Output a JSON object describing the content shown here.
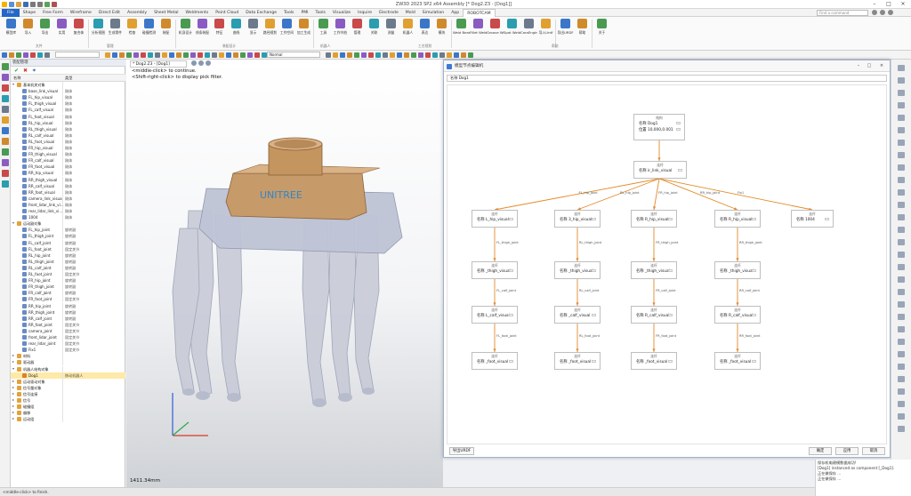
{
  "app": {
    "title": "ZW3D 2023 SP2 x64        Assembly  [* Dog2.Z3 - [Dog1]]",
    "search_placeholder": "Find a command"
  },
  "menu": {
    "tabs": [
      "File",
      "Shape",
      "Free Form",
      "Wireframe",
      "Direct Edit",
      "Assembly",
      "Sheet Metal",
      "Weldments",
      "Point Cloud",
      "Data Exchange",
      "Tools",
      "PMI",
      "Tools",
      "Visualize",
      "Inquire",
      "Electrode",
      "Mold",
      "Simulation",
      "App",
      "ROBOTCAM"
    ]
  },
  "ribbon": {
    "buttons": [
      "模型库",
      "导入",
      "导出",
      "实用",
      "复合体",
      "分析视图",
      "生成零件",
      "检查",
      "碰撞检测",
      "装配",
      "机身设计",
      "线条装配",
      "特征",
      "曲线",
      "显示",
      "路径规划",
      "工作空间",
      "加工生成",
      "工具",
      "工作节拍",
      "管理",
      "关联",
      "测量",
      "机器人",
      "表达",
      "模块",
      "Weld Bead",
      "Fillet Weld",
      "Groove Weld",
      "Spot Weld",
      "CaraEngine",
      "导入Urdf",
      "导出URDF",
      "帮助",
      "关于"
    ],
    "groups": [
      "文件",
      "管理",
      "装配设计",
      "机器人",
      "工艺规划",
      "帮助"
    ]
  },
  "toolbar": {
    "filter_value": "",
    "style_value": "Normal"
  },
  "manager": {
    "title": "装配管理",
    "col_name": "名称",
    "col_type": "类型",
    "rows": [
      {
        "name": "基本机关对象",
        "type": "",
        "level": 0,
        "kind": "folder"
      },
      {
        "name": "base_link_visual",
        "type": "刚体",
        "level": 1,
        "kind": "body"
      },
      {
        "name": "FL_hip_visual",
        "type": "刚体",
        "level": 1,
        "kind": "body"
      },
      {
        "name": "FL_thigh_visual",
        "type": "刚体",
        "level": 1,
        "kind": "body"
      },
      {
        "name": "FL_calf_visual",
        "type": "刚体",
        "level": 1,
        "kind": "body"
      },
      {
        "name": "FL_foot_visual",
        "type": "刚体",
        "level": 1,
        "kind": "body"
      },
      {
        "name": "RL_hip_visual",
        "type": "刚体",
        "level": 1,
        "kind": "body"
      },
      {
        "name": "RL_thigh_visual",
        "type": "刚体",
        "level": 1,
        "kind": "body"
      },
      {
        "name": "RL_calf_visual",
        "type": "刚体",
        "level": 1,
        "kind": "body"
      },
      {
        "name": "RL_foot_visual",
        "type": "刚体",
        "level": 1,
        "kind": "body"
      },
      {
        "name": "FR_hip_visual",
        "type": "刚体",
        "level": 1,
        "kind": "body"
      },
      {
        "name": "FR_thigh_visual",
        "type": "刚体",
        "level": 1,
        "kind": "body"
      },
      {
        "name": "FR_calf_visual",
        "type": "刚体",
        "level": 1,
        "kind": "body"
      },
      {
        "name": "FR_foot_visual",
        "type": "刚体",
        "level": 1,
        "kind": "body"
      },
      {
        "name": "RR_hip_visual",
        "type": "刚体",
        "level": 1,
        "kind": "body"
      },
      {
        "name": "RR_thigh_visual",
        "type": "刚体",
        "level": 1,
        "kind": "body"
      },
      {
        "name": "RR_calf_visual",
        "type": "刚体",
        "level": 1,
        "kind": "body"
      },
      {
        "name": "RR_foot_visual",
        "type": "刚体",
        "level": 1,
        "kind": "body"
      },
      {
        "name": "camera_link_visual",
        "type": "刚体",
        "level": 1,
        "kind": "body"
      },
      {
        "name": "front_lidar_link_vi...",
        "type": "刚体",
        "level": 1,
        "kind": "body"
      },
      {
        "name": "rear_lidar_link_vi...",
        "type": "刚体",
        "level": 1,
        "kind": "body"
      },
      {
        "name": "1004",
        "type": "刚体",
        "level": 1,
        "kind": "body"
      },
      {
        "name": "运动副对象",
        "type": "",
        "level": 0,
        "kind": "folder"
      },
      {
        "name": "FL_hip_joint",
        "type": "旋转副",
        "level": 1,
        "kind": "joint"
      },
      {
        "name": "FL_thigh_joint",
        "type": "旋转副",
        "level": 1,
        "kind": "joint"
      },
      {
        "name": "FL_calf_joint",
        "type": "旋转副",
        "level": 1,
        "kind": "joint"
      },
      {
        "name": "FL_foot_joint",
        "type": "固定关节",
        "level": 1,
        "kind": "joint"
      },
      {
        "name": "RL_hip_joint",
        "type": "旋转副",
        "level": 1,
        "kind": "joint"
      },
      {
        "name": "RL_thigh_joint",
        "type": "旋转副",
        "level": 1,
        "kind": "joint"
      },
      {
        "name": "RL_calf_joint",
        "type": "旋转副",
        "level": 1,
        "kind": "joint"
      },
      {
        "name": "RL_foot_joint",
        "type": "固定关节",
        "level": 1,
        "kind": "joint"
      },
      {
        "name": "FR_hip_joint",
        "type": "旋转副",
        "level": 1,
        "kind": "joint"
      },
      {
        "name": "FR_thigh_joint",
        "type": "旋转副",
        "level": 1,
        "kind": "joint"
      },
      {
        "name": "FR_calf_joint",
        "type": "旋转副",
        "level": 1,
        "kind": "joint"
      },
      {
        "name": "FR_foot_joint",
        "type": "固定关节",
        "level": 1,
        "kind": "joint"
      },
      {
        "name": "RR_hip_joint",
        "type": "旋转副",
        "level": 1,
        "kind": "joint"
      },
      {
        "name": "RR_thigh_joint",
        "type": "旋转副",
        "level": 1,
        "kind": "joint"
      },
      {
        "name": "RR_calf_joint",
        "type": "旋转副",
        "level": 1,
        "kind": "joint"
      },
      {
        "name": "RR_foot_joint",
        "type": "固定关节",
        "level": 1,
        "kind": "joint"
      },
      {
        "name": "camera_joint",
        "type": "固定关节",
        "level": 1,
        "kind": "joint"
      },
      {
        "name": "front_lidar_joint",
        "type": "固定关节",
        "level": 1,
        "kind": "joint"
      },
      {
        "name": "rear_lidar_joint",
        "type": "固定关节",
        "level": 1,
        "kind": "joint"
      },
      {
        "name": "Fix1",
        "type": "固定关节",
        "level": 1,
        "kind": "joint"
      },
      {
        "name": "材料",
        "type": "",
        "level": 0,
        "kind": "folder2"
      },
      {
        "name": "驱动器",
        "type": "",
        "level": 0,
        "kind": "folder2"
      },
      {
        "name": "机器人结构对象",
        "type": "",
        "level": 0,
        "kind": "folder"
      },
      {
        "name": "Dog1",
        "type": "移动机器人",
        "level": 1,
        "kind": "robot",
        "selected": true
      },
      {
        "name": "运动驱动对象",
        "type": "",
        "level": 0,
        "kind": "folder2"
      },
      {
        "name": "信号量对象",
        "type": "",
        "level": 0,
        "kind": "folder2"
      },
      {
        "name": "信号连接",
        "type": "",
        "level": 0,
        "kind": "folder2"
      },
      {
        "name": "信号",
        "type": "",
        "level": 0,
        "kind": "folder2"
      },
      {
        "name": "碰撞组",
        "type": "",
        "level": 0,
        "kind": "folder2"
      },
      {
        "name": "偏移",
        "type": "",
        "level": 0,
        "kind": "folder2"
      },
      {
        "name": "运动组",
        "type": "",
        "level": 0,
        "kind": "folder2"
      }
    ]
  },
  "viewport": {
    "tab_label": "* Dog2.Z3 - [Dog1]",
    "hint_line1": "<middle-click> to continue.",
    "hint_line2": "<Shift-right-click> to display pick filter.",
    "measure": "1411.34mm",
    "model_label": "UNITREE"
  },
  "dialog": {
    "title": "模型节点编辑机",
    "name_bar": "名称  Dog1",
    "buttons": {
      "export_urdf": "导出URDF",
      "ok": "确定",
      "apply": "应用",
      "cancel": "取消"
    },
    "graph": {
      "root": {
        "tag": "结构",
        "row1": "名称 Dog1",
        "row2": "位置 10,000,0.001"
      },
      "base": {
        "tag": "连杆",
        "row1": "名称 ir_link_visual"
      },
      "branch_edges": [
        "FL_hip_joint",
        "RL_hip_joint",
        "FR_hip_joint",
        "RR_hip_joint",
        "Fix1"
      ],
      "legs": [
        {
          "hip": "名称 L_hip_visual",
          "thigh_edge": "FL_thigh_joint",
          "thigh": "名称 _thigh_visual",
          "calf_edge": "FL_calf_joint",
          "calf": "名称 L_calf_visual",
          "foot_edge": "FL_foot_joint",
          "foot": "名称 _foot_visual"
        },
        {
          "hip": "名称 3_hip_visual",
          "thigh_edge": "RL_thigh_joint",
          "thigh": "名称 _thigh_visual",
          "calf_edge": "RL_calf_joint",
          "calf": "名称 _calf_visual",
          "foot_edge": "RL_foot_joint",
          "foot": "名称 _foot_visual"
        },
        {
          "hip": "名称 R_hip_visual",
          "thigh_edge": "FR_thigh_joint",
          "thigh": "名称 _thigh_visual",
          "calf_edge": "FR_calf_joint",
          "calf": "名称 R_calf_visual",
          "foot_edge": "FR_foot_joint",
          "foot": "名称 _foot_visual"
        },
        {
          "hip": "名称 R_hip_visual",
          "thigh_edge": "RR_thigh_joint",
          "thigh": "名称 _thigh_visual",
          "calf_edge": "RR_calf_joint",
          "calf": "名称 R_calf_visual",
          "foot_edge": "RR_foot_joint",
          "foot": "名称 _foot_visual"
        }
      ],
      "extra": {
        "tag": "连杆",
        "row1": "名称 1004"
      },
      "node_tag": "连杆"
    }
  },
  "output": {
    "lines": [
      "保存机电建模数据成功!",
      "[Dog1] instanced as component [_Dog1].",
      "正在做保存 ...",
      "正在做保存 ..."
    ]
  },
  "status": {
    "text": "<middle-click> to finish."
  },
  "colors": {
    "accent": "#2467c8",
    "edge": "#e38a2a",
    "body_orange": "#c79a6a",
    "body_gray": "#bfc4d6",
    "selected_row": "#fde9a8"
  }
}
